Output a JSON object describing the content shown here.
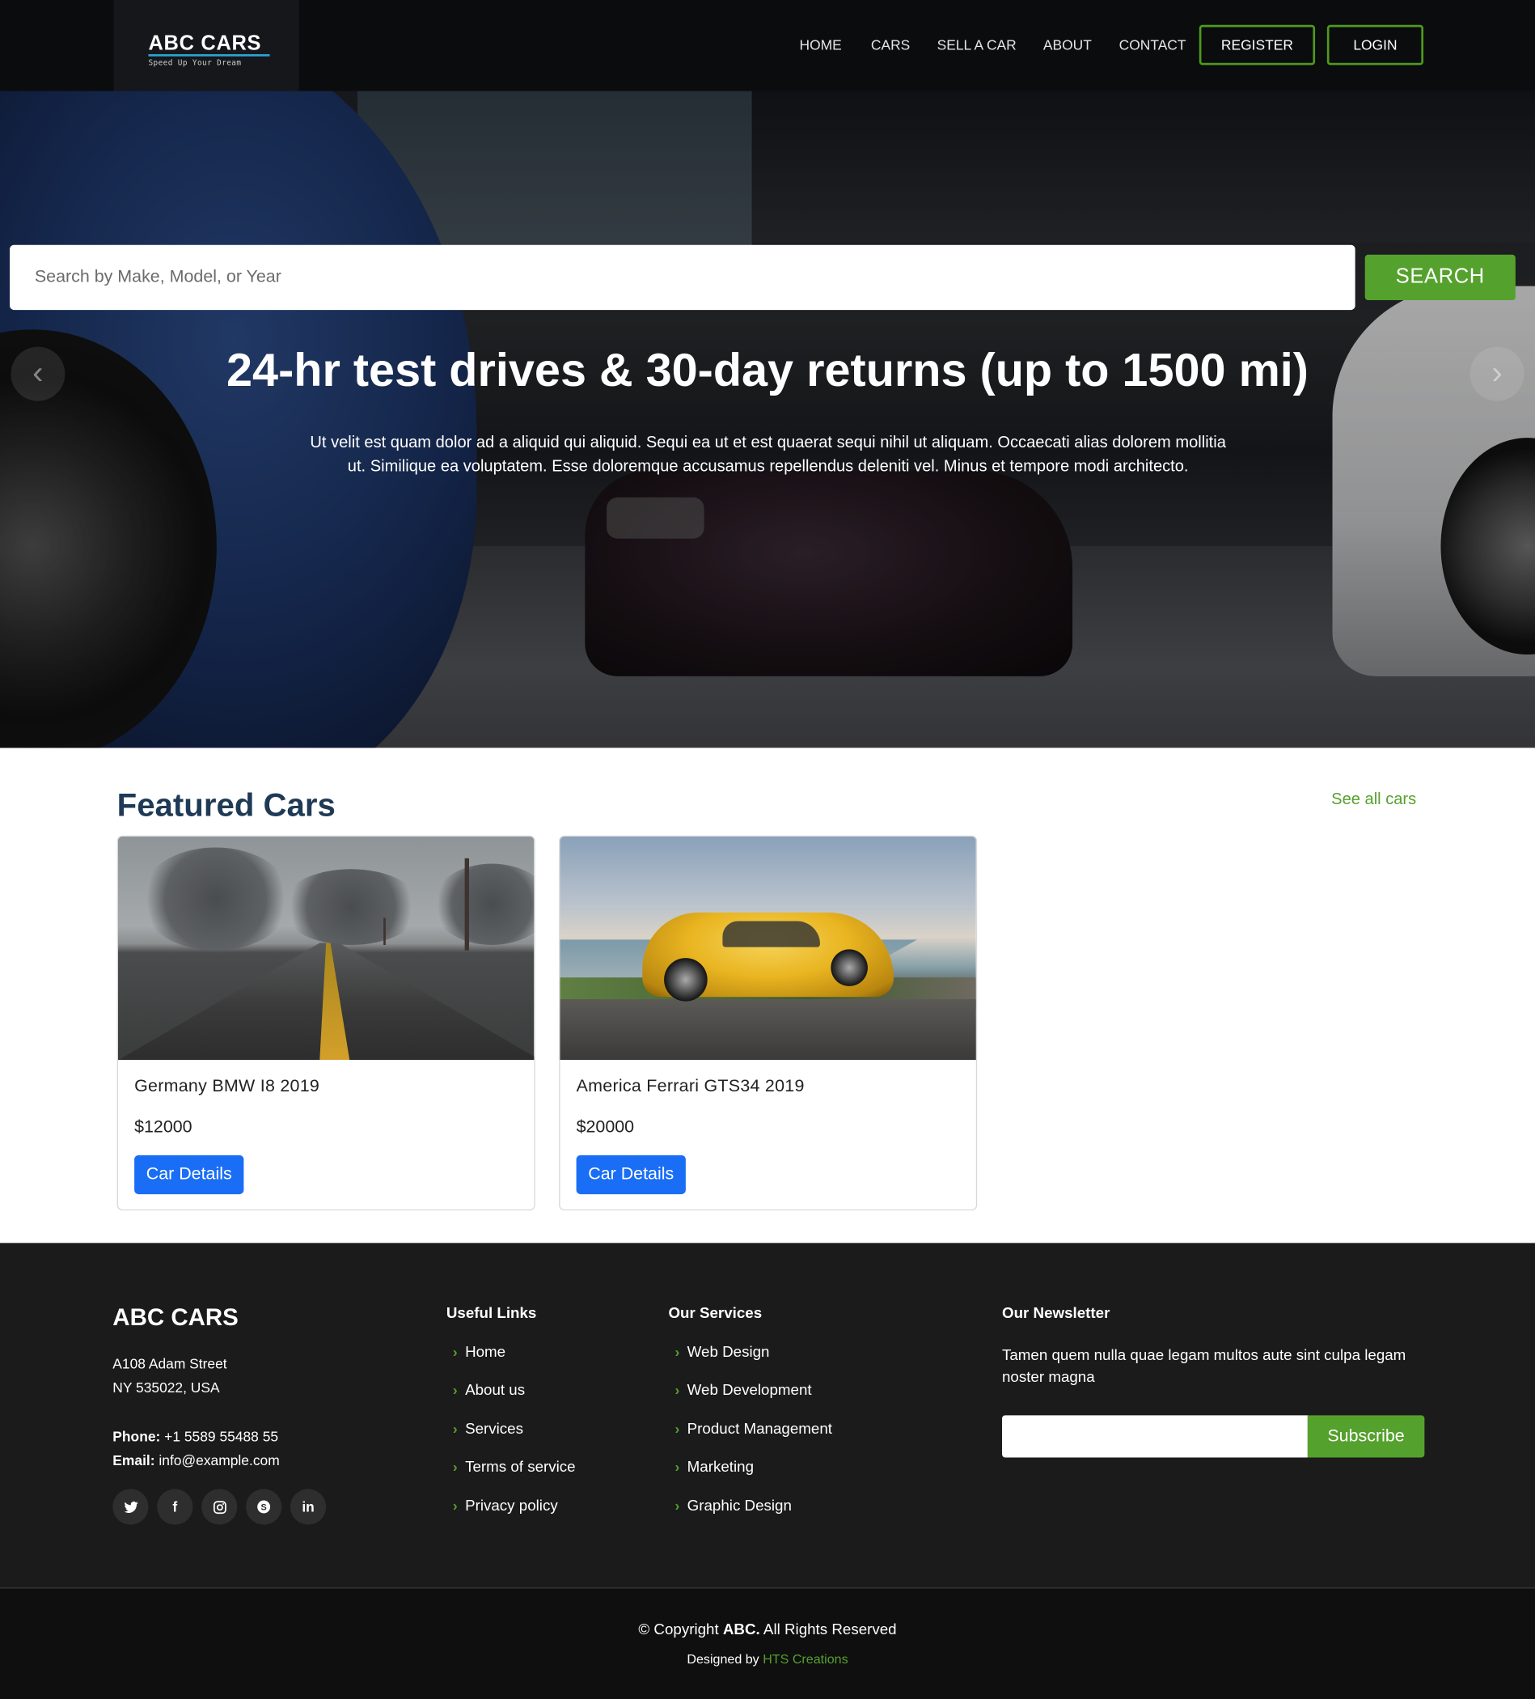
{
  "brand": {
    "name": "ABC CARS",
    "tagline": "Speed Up Your Dream"
  },
  "nav": {
    "links": [
      "HOME",
      "CARS",
      "SELL A CAR",
      "ABOUT",
      "CONTACT"
    ],
    "register": "REGISTER",
    "login": "LOGIN",
    "accent_color": "#4e9a1e"
  },
  "search": {
    "placeholder": "Search by Make, Model, or Year",
    "button": "SEARCH",
    "button_color": "#55a12d"
  },
  "hero": {
    "title": "24-hr test drives & 30-day returns (up to 1500 mi)",
    "text": "Ut velit est quam dolor ad a aliquid qui aliquid. Sequi ea ut et est quaerat sequi nihil ut aliquam. Occaecati alias dolorem mollitia ut. Similique ea voluptatem. Esse doloremque accusamus repellendus deleniti vel. Minus et tempore modi architecto.",
    "prev_icon": "chevron-left-icon",
    "next_icon": "chevron-right-icon"
  },
  "featured": {
    "title": "Featured Cars",
    "see_all": "See all cars",
    "cards": [
      {
        "name": "Germany BMW I8 2019",
        "price": "$12000",
        "button": "Car Details",
        "image": "foggy-road-image"
      },
      {
        "name": "America Ferrari GTS34 2019",
        "price": "$20000",
        "button": "Car Details",
        "image": "yellow-ferrari-image"
      }
    ]
  },
  "footer": {
    "brand": "ABC CARS",
    "address_line1": "A108 Adam Street",
    "address_line2": "NY 535022, USA",
    "phone_label": "Phone:",
    "phone": "+1 5589 55488 55",
    "email_label": "Email:",
    "email": "info@example.com",
    "socials": [
      "twitter-icon",
      "facebook-icon",
      "instagram-icon",
      "skype-icon",
      "linkedin-icon"
    ],
    "useful_links_title": "Useful Links",
    "useful_links": [
      "Home",
      "About us",
      "Services",
      "Terms of service",
      "Privacy policy"
    ],
    "services_title": "Our Services",
    "services": [
      "Web Design",
      "Web Development",
      "Product Management",
      "Marketing",
      "Graphic Design"
    ],
    "newsletter_title": "Our Newsletter",
    "newsletter_text": "Tamen quem nulla quae legam multos aute sint culpa legam noster magna",
    "subscribe": "Subscribe"
  },
  "bottom": {
    "copyright_prefix": "© Copyright",
    "copyright_brand": "ABC.",
    "copyright_suffix": "All Rights Reserved",
    "designed_by": "Designed by",
    "designer": "HTS Creations"
  }
}
